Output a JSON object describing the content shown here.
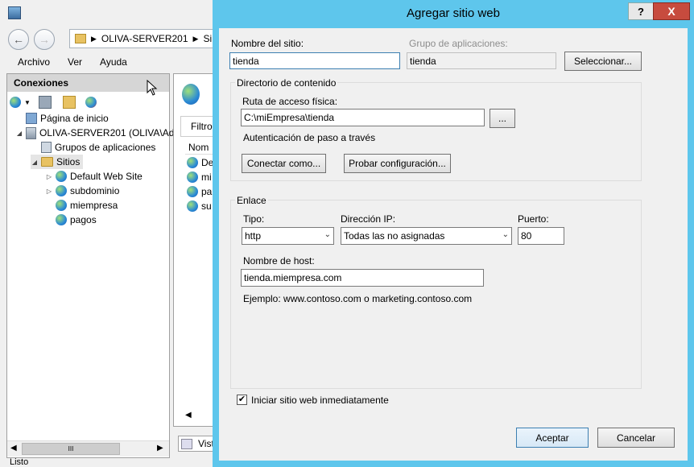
{
  "app": {
    "address_path": "OLIVA-SERVER201",
    "address_tail": "Si",
    "menu": [
      "Archivo",
      "Ver",
      "Ayuda"
    ],
    "connections_title": "Conexiones",
    "tree": [
      {
        "label": "Página de inicio",
        "icon": "home-icon"
      },
      {
        "label": "OLIVA-SERVER201 (OLIVA\\Ad",
        "icon": "server-icon"
      },
      {
        "label": "Grupos de aplicaciones",
        "icon": "app-pools-icon"
      },
      {
        "label": "Sitios",
        "icon": "folder-icon"
      },
      {
        "label": "Default Web Site",
        "icon": "globe-icon"
      },
      {
        "label": "subdominio",
        "icon": "globe-icon"
      },
      {
        "label": "miempresa",
        "icon": "globe-icon"
      },
      {
        "label": "pagos",
        "icon": "globe-icon"
      }
    ],
    "center": {
      "filter_label": "Filtro",
      "column_header": "Nom",
      "rows": [
        "De",
        "mi",
        "pa",
        "su"
      ],
      "view_tab": "Vista"
    },
    "status_text": "Listo"
  },
  "dialog": {
    "title": "Agregar sitio web",
    "help": "?",
    "close": "X",
    "site_name_label": "Nombre del sitio:",
    "site_name_value": "tienda",
    "app_pool_label": "Grupo de aplicaciones:",
    "app_pool_value": "tienda",
    "select_button": "Seleccionar...",
    "content_group_label": "Directorio de contenido",
    "physical_path_label": "Ruta de acceso física:",
    "physical_path_value": "C:\\miEmpresa\\tienda",
    "browse_button": "...",
    "passthrough_auth": "Autenticación de paso a través",
    "connect_as_button": "Conectar como...",
    "test_settings_button": "Probar configuración...",
    "binding_group_label": "Enlace",
    "type_label": "Tipo:",
    "type_value": "http",
    "ip_label": "Dirección IP:",
    "ip_value": "Todas las no asignadas",
    "port_label": "Puerto:",
    "port_value": "80",
    "host_label": "Nombre de host:",
    "host_value": "tienda.miempresa.com",
    "example_text": "Ejemplo: www.contoso.com o marketing.contoso.com",
    "start_label": "Iniciar sitio web inmediatamente",
    "start_checked": true,
    "ok_button": "Aceptar",
    "cancel_button": "Cancelar"
  }
}
